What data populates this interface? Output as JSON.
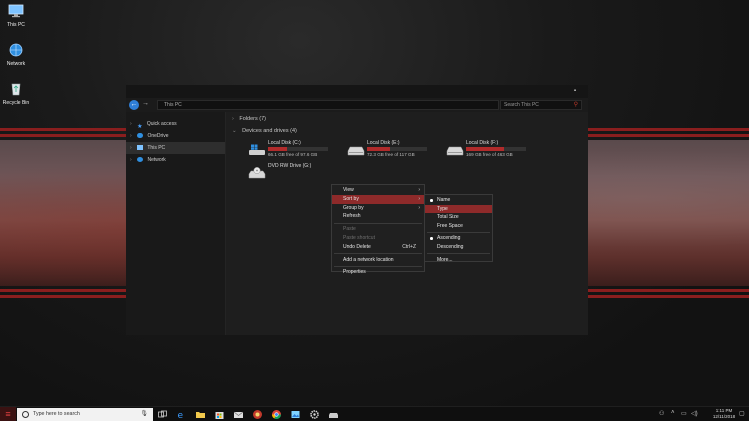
{
  "desktop": {
    "icons": [
      {
        "label": "This PC",
        "icon": "this-pc-icon"
      },
      {
        "label": "Network",
        "icon": "network-icon"
      },
      {
        "label": "Recycle Bin",
        "icon": "recycle-bin-icon"
      }
    ]
  },
  "window": {
    "address": "This PC",
    "search_placeholder": "Search This PC",
    "sidebar": {
      "items": [
        {
          "label": "Quick access",
          "icon": "star-icon"
        },
        {
          "label": "OneDrive",
          "icon": "cloud-icon"
        },
        {
          "label": "This PC",
          "icon": "this-pc-icon",
          "selected": true
        },
        {
          "label": "Network",
          "icon": "network-icon"
        }
      ]
    },
    "groups": {
      "folders": "Folders (7)",
      "devices": "Devices and drives (4)"
    },
    "drives": [
      {
        "name": "Local Disk (C:)",
        "capacity": "66.1 GB free of 97.6 GB",
        "used_fraction": 0.32,
        "icon": "windows-drive-icon"
      },
      {
        "name": "Local Disk (E:)",
        "capacity": "72.3 GB free of 117 GB",
        "used_fraction": 0.38,
        "icon": "drive-icon"
      },
      {
        "name": "Local Disk (F:)",
        "capacity": "169 GB free of 463 GB",
        "used_fraction": 0.64,
        "icon": "drive-icon"
      },
      {
        "name": "DVD RW Drive (G:)",
        "icon": "dvd-drive-icon"
      }
    ]
  },
  "context_menu": {
    "items": [
      {
        "label": "View",
        "submenu": true
      },
      {
        "label": "Sort by",
        "submenu": true,
        "highlighted": true
      },
      {
        "label": "Group by",
        "submenu": true
      },
      {
        "label": "Refresh"
      },
      {
        "separator": true
      },
      {
        "label": "Paste",
        "disabled": true
      },
      {
        "label": "Paste shortcut",
        "disabled": true
      },
      {
        "label": "Undo Delete",
        "shortcut": "Ctrl+Z"
      },
      {
        "separator": true
      },
      {
        "label": "Add a network location"
      },
      {
        "separator": true
      },
      {
        "label": "Properties"
      }
    ],
    "sort_submenu": [
      {
        "label": "Name",
        "checked": true
      },
      {
        "label": "Type",
        "highlighted": true
      },
      {
        "label": "Total Size"
      },
      {
        "label": "Free Space"
      },
      {
        "separator": true
      },
      {
        "label": "Ascending",
        "checked": true
      },
      {
        "label": "Descending"
      },
      {
        "separator": true
      },
      {
        "label": "More..."
      }
    ]
  },
  "taskbar": {
    "search_placeholder": "Type here to search",
    "pinned": [
      "task-view-icon",
      "edge-icon",
      "file-explorer-icon",
      "store-icon",
      "mail-icon",
      "app-icon",
      "chrome-icon",
      "photos-icon",
      "settings-icon",
      "drive-app-icon"
    ],
    "time": "1:11 PM",
    "date": "12/11/2018"
  },
  "colors": {
    "accent": "#8e2a2a",
    "drive_bar": "#b12b2b",
    "window_bg": "#1e1e1e",
    "link_blue": "#2f7fd8"
  }
}
